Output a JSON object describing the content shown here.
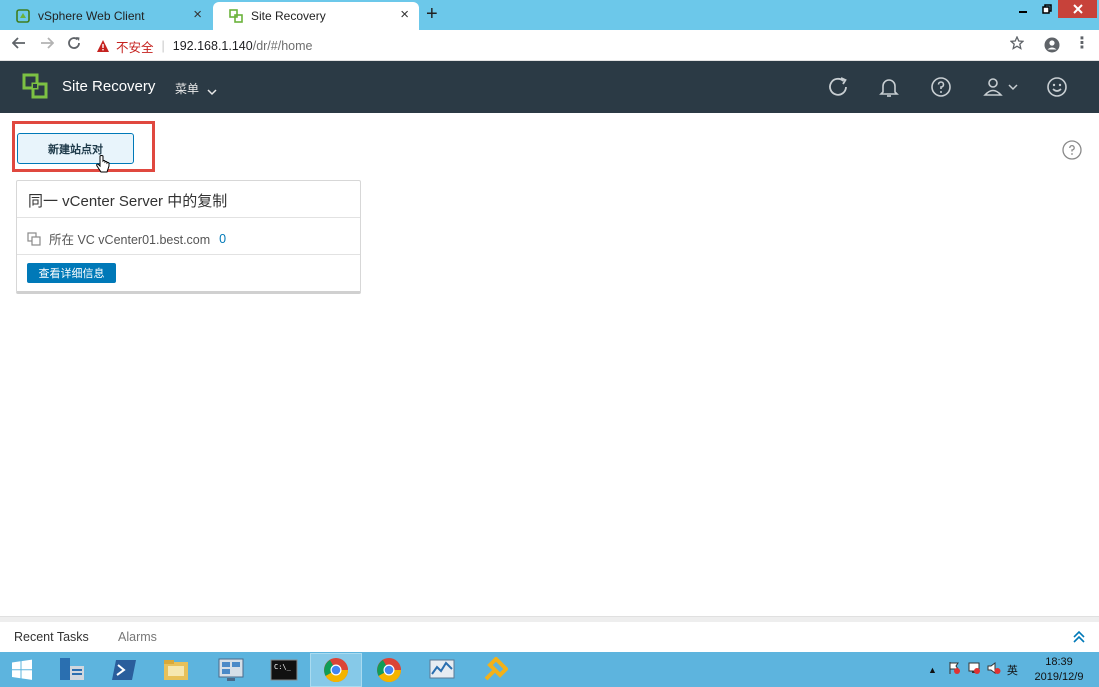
{
  "browser": {
    "tabs": [
      {
        "title": "vSphere Web Client",
        "active": false
      },
      {
        "title": "Site Recovery",
        "active": true
      }
    ],
    "new_tab_label": "+",
    "address": {
      "security_label": "不安全",
      "host": "192.168.1.140",
      "path": "/dr/#/home"
    }
  },
  "header": {
    "app_title": "Site Recovery",
    "menu_label": "菜单"
  },
  "main": {
    "new_pair_button": "新建站点对",
    "card": {
      "title": "同一 vCenter Server 中的复制",
      "location_label": "所在 VC vCenter01.best.com",
      "count": "0",
      "details_button": "查看详细信息"
    }
  },
  "bottom_panel": {
    "tabs": [
      "Recent Tasks",
      "Alarms"
    ]
  },
  "taskbar": {
    "tray_ime": "英",
    "time": "18:39",
    "date": "2019/12/9"
  },
  "colors": {
    "tab_strip": "#6cc8ea",
    "app_header": "#2b3a45",
    "accent_blue": "#0079b8",
    "highlight_red": "#e0483f",
    "taskbar": "#5db4de"
  },
  "icons": [
    "vsphere-icon",
    "site-recovery-icon",
    "refresh-icon",
    "bell-icon",
    "help-icon",
    "user-icon",
    "smiley-icon",
    "copy-icon",
    "chevron-up-icon",
    "windows-start-icon",
    "chrome-icon"
  ]
}
